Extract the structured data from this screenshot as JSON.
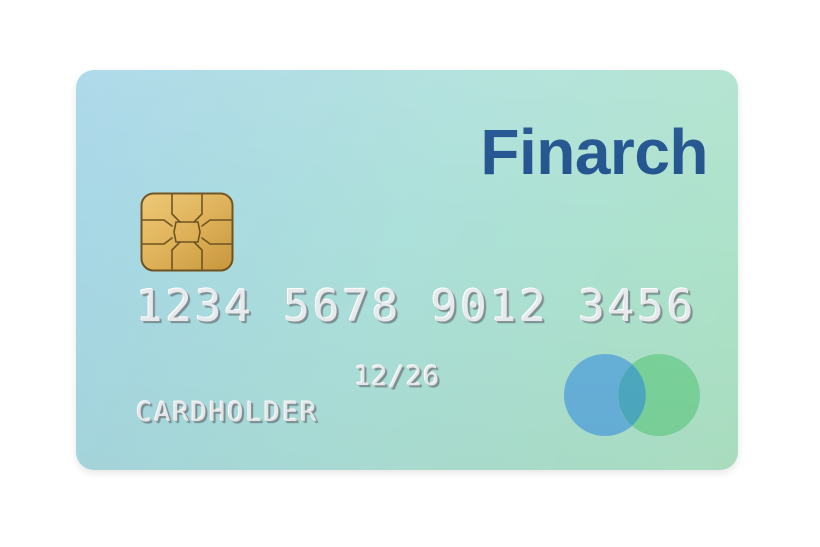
{
  "card": {
    "brand": "Finarch",
    "number": "1234 5678 9012 3456",
    "expiry": "12/26",
    "holder": "CARDHOLDER"
  },
  "icons": {
    "chip": "emv-chip-icon",
    "network": "network-logo-icon"
  },
  "colors": {
    "brand": "#1c4f8c",
    "card_gradient_start": "#a6d5e8",
    "card_gradient_end": "#aee3c4",
    "chip_gold": "#e2b65a",
    "network_left": "#5aa8dc",
    "network_right": "#6ecf8f"
  }
}
